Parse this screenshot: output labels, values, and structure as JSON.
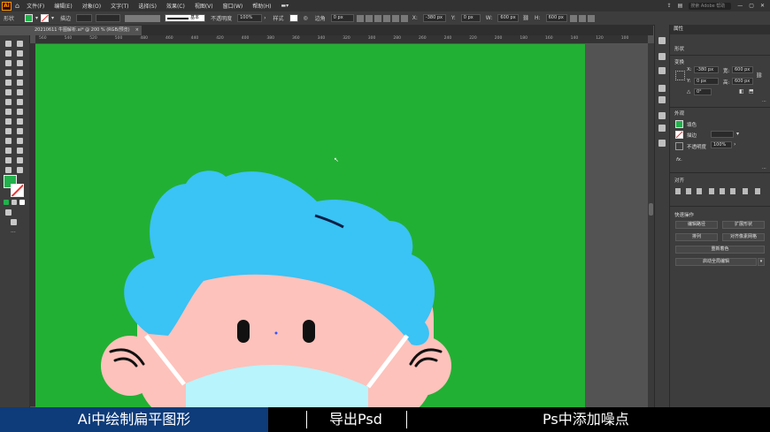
{
  "menubar": {
    "app_icon": "Ai",
    "items": [
      "文件(F)",
      "编辑(E)",
      "对象(O)",
      "文字(T)",
      "选择(S)",
      "效果(C)",
      "视图(V)",
      "窗口(W)",
      "帮助(H)"
    ],
    "search_placeholder": "搜索 Adobe 帮助"
  },
  "control": {
    "selection_label": "形状",
    "stroke_label": "描边",
    "stroke_style": "基本",
    "opacity_label": "不透明度",
    "opacity_value": "100%",
    "style_label": "样式",
    "corner_label": "边角",
    "corner_value": "0 px",
    "x_value": "-380 px",
    "y_value": "0 px",
    "w_value": "600 px",
    "h_value": "600 px"
  },
  "document": {
    "tab_title": "20210611 牛图解析.ai* @ 200 % (RGB/预览)",
    "close": "×"
  },
  "ruler": {
    "ticks": [
      "560",
      "540",
      "520",
      "500",
      "480",
      "460",
      "440",
      "420",
      "400",
      "380",
      "360",
      "340",
      "320",
      "300",
      "280",
      "260",
      "240",
      "220",
      "200",
      "180",
      "160",
      "140",
      "120",
      "100"
    ]
  },
  "properties": {
    "panel_title": "属性",
    "section_shape": "形状",
    "section_transform": "变换",
    "x_label": "X:",
    "x_value": "-380 px",
    "y_label": "Y:",
    "y_value": "0 px",
    "w_label": "宽:",
    "w_value": "600 px",
    "h_label": "高:",
    "h_value": "600 px",
    "angle_label": "△",
    "angle_value": "0°",
    "section_appearance": "外观",
    "fill_label": "填色",
    "stroke_label": "描边",
    "opacity_label": "不透明度",
    "opacity_value": "100%",
    "fx_label": "fx.",
    "section_align": "对齐",
    "section_quick": "快速操作",
    "btn_edit_path": "编辑路径",
    "btn_expand": "扩展形状",
    "btn_arrange": "排列",
    "btn_pixel": "对齐像素网格",
    "btn_recolor": "重新着色",
    "btn_global_edit": "启动全局编辑",
    "more": "···"
  },
  "colors": {
    "artboard_green": "#22b034",
    "hair_blue": "#3ac3f5",
    "skin_pink": "#fdc2bb",
    "mask_blue": "#b8f4fc",
    "caption_blue": "#0e3b79"
  },
  "caption": {
    "segment1": "Ai中绘制扁平图形",
    "segment2": "导出Psd",
    "segment3": "Ps中添加噪点"
  }
}
